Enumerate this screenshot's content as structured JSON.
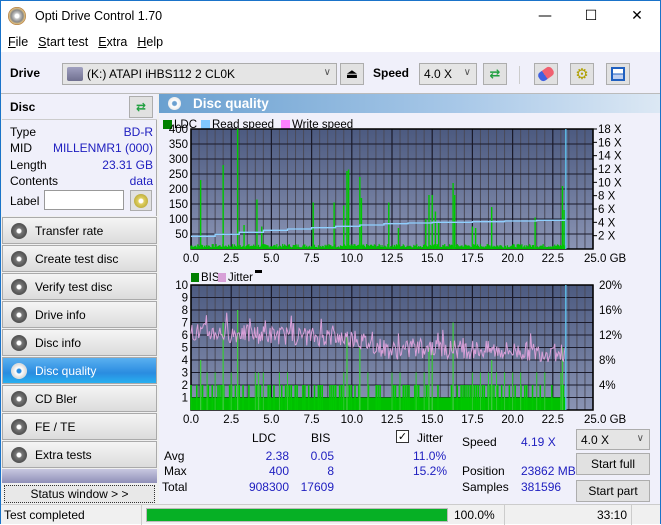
{
  "window": {
    "title": "Opti Drive Control 1.70",
    "minimize": "—",
    "maximize": "☐",
    "close": "✕"
  },
  "menu": [
    {
      "label": "File",
      "u": "F",
      "rest": "ile"
    },
    {
      "label": "Start test",
      "u": "S",
      "rest": "tart test"
    },
    {
      "label": "Extra",
      "u": "E",
      "pre": "",
      "rest": "xtra"
    },
    {
      "label": "Help",
      "u": "H",
      "rest": "elp"
    }
  ],
  "toolbar": {
    "drive_label": "Drive",
    "drive_value": "(K:)  ATAPI iHBS112  2 CL0K",
    "speed_label": "Speed",
    "speed_value": "4.0 X",
    "icons": [
      "eject-icon",
      "refresh-icon",
      "erase-icon",
      "settings-icon",
      "save-icon"
    ]
  },
  "disc": {
    "header": "Disc",
    "fields": [
      {
        "label": "Type",
        "value": "BD-R"
      },
      {
        "label": "MID",
        "value": "MILLENMR1 (000)"
      },
      {
        "label": "Length",
        "value": "23.31 GB"
      },
      {
        "label": "Contents",
        "value": "data"
      }
    ],
    "label_field": "Label",
    "label_value": ""
  },
  "nav": [
    {
      "label": "Transfer rate",
      "active": false
    },
    {
      "label": "Create test disc",
      "active": false
    },
    {
      "label": "Verify test disc",
      "active": false
    },
    {
      "label": "Drive info",
      "active": false
    },
    {
      "label": "Disc info",
      "active": false
    },
    {
      "label": "Disc quality",
      "active": true
    },
    {
      "label": "CD Bler",
      "active": false
    },
    {
      "label": "FE / TE",
      "active": false
    },
    {
      "label": "Extra tests",
      "active": false
    }
  ],
  "status_window_label": "Status window > >",
  "panel_title": "Disc quality",
  "chart_data": [
    {
      "type": "bar",
      "title": "LDC / Read speed",
      "legend": [
        "LDC",
        "Read speed",
        "Write speed"
      ],
      "legend_colors": [
        "#008000",
        "#80c8ff",
        "#ff80ff"
      ],
      "xlabel": "GB",
      "xlim": [
        0,
        25
      ],
      "x_ticks": [
        "0.0",
        "2.5",
        "5.0",
        "7.5",
        "10.0",
        "12.5",
        "15.0",
        "17.5",
        "20.0",
        "22.5",
        "25.0 GB"
      ],
      "ylim": [
        0,
        400
      ],
      "y_ticks": [
        "400",
        "350",
        "300",
        "250",
        "200",
        "150",
        "100",
        "50"
      ],
      "y2lim": [
        0,
        18
      ],
      "y2_ticks": [
        "18 X",
        "16 X",
        "14 X",
        "12 X",
        "10 X",
        "8 X",
        "6 X",
        "4 X",
        "2 X"
      ],
      "ldc_spikes": [
        [
          0.6,
          230
        ],
        [
          2.0,
          280
        ],
        [
          2.9,
          400
        ],
        [
          3.3,
          80
        ],
        [
          4.1,
          165
        ],
        [
          4.4,
          75
        ],
        [
          7.6,
          155
        ],
        [
          8.9,
          155
        ],
        [
          9.5,
          145
        ],
        [
          9.7,
          260
        ],
        [
          9.8,
          265
        ],
        [
          10.5,
          240
        ],
        [
          10.6,
          170
        ],
        [
          12.3,
          155
        ],
        [
          12.9,
          70
        ],
        [
          14.6,
          100
        ],
        [
          14.8,
          180
        ],
        [
          15.0,
          180
        ],
        [
          15.2,
          125
        ],
        [
          15.4,
          90
        ],
        [
          16.3,
          220
        ],
        [
          16.4,
          180
        ],
        [
          17.5,
          75
        ],
        [
          17.7,
          70
        ],
        [
          18.7,
          140
        ],
        [
          21.4,
          105
        ],
        [
          23.1,
          210
        ],
        [
          23.2,
          130
        ]
      ],
      "read_speed": [
        [
          0,
          1.9
        ],
        [
          1.5,
          2.2
        ],
        [
          3.0,
          2.5
        ],
        [
          4.5,
          2.8
        ],
        [
          6.0,
          3.0
        ],
        [
          7.5,
          3.2
        ],
        [
          9.0,
          3.4
        ],
        [
          10.5,
          3.6
        ],
        [
          12.0,
          3.8
        ],
        [
          13.5,
          3.9
        ],
        [
          15.0,
          4.0
        ],
        [
          17.5,
          4.1
        ],
        [
          19.5,
          4.2
        ],
        [
          21.5,
          4.3
        ],
        [
          23.3,
          4.4
        ]
      ],
      "end_marker_gb": 23.31
    },
    {
      "type": "bar",
      "title": "BIS / Jitter",
      "legend": [
        "BIS",
        "Jitter"
      ],
      "legend_colors": [
        "#008000",
        "#d8a0d8"
      ],
      "xlabel": "GB",
      "xlim": [
        0,
        25
      ],
      "x_ticks": [
        "0.0",
        "2.5",
        "5.0",
        "7.5",
        "10.0",
        "12.5",
        "15.0",
        "17.5",
        "20.0",
        "22.5",
        "25.0 GB"
      ],
      "ylim": [
        0,
        10
      ],
      "y_ticks": [
        "10",
        "9",
        "8",
        "7",
        "6",
        "5",
        "4",
        "3",
        "2",
        "1"
      ],
      "y2lim": [
        0,
        20
      ],
      "y2_ticks": [
        "20%",
        "16%",
        "12%",
        "8%",
        "4%"
      ],
      "bis_spikes": [
        [
          0.6,
          4
        ],
        [
          2.0,
          7
        ],
        [
          2.9,
          8
        ],
        [
          4.2,
          3
        ],
        [
          9.7,
          6
        ],
        [
          10.5,
          5
        ],
        [
          14.8,
          5
        ],
        [
          15.0,
          5
        ],
        [
          16.3,
          7
        ],
        [
          18.7,
          4
        ],
        [
          23.1,
          5
        ]
      ],
      "bis_base": 1,
      "jitter_avg_pct": 11.0,
      "jitter_trend": [
        [
          0,
          12.5
        ],
        [
          5,
          12.0
        ],
        [
          10,
          11.5
        ],
        [
          12.5,
          9.5
        ],
        [
          15,
          9.8
        ],
        [
          20,
          9.5
        ],
        [
          23.3,
          9.0
        ]
      ],
      "end_marker_gb": 23.31
    }
  ],
  "stats": {
    "col_ldc": "LDC",
    "col_bis": "BIS",
    "jitter_label": "Jitter",
    "jitter_checked": true,
    "rows": [
      {
        "label": "Avg",
        "ldc": "2.38",
        "bis": "0.05",
        "jitter": "11.0%"
      },
      {
        "label": "Max",
        "ldc": "400",
        "bis": "8",
        "jitter": "15.2%"
      },
      {
        "label": "Total",
        "ldc": "908300",
        "bis": "17609",
        "jitter": ""
      }
    ],
    "speed_label": "Speed",
    "speed_value": "4.19 X",
    "position_label": "Position",
    "position_value": "23862 MB",
    "samples_label": "Samples",
    "samples_value": "381596",
    "speed_select": "4.0 X",
    "start_full": "Start full",
    "start_part": "Start part"
  },
  "statusbar": {
    "text": "Test completed",
    "progress_pct": 100.0,
    "progress_label": "100.0%",
    "time": "33:10"
  }
}
